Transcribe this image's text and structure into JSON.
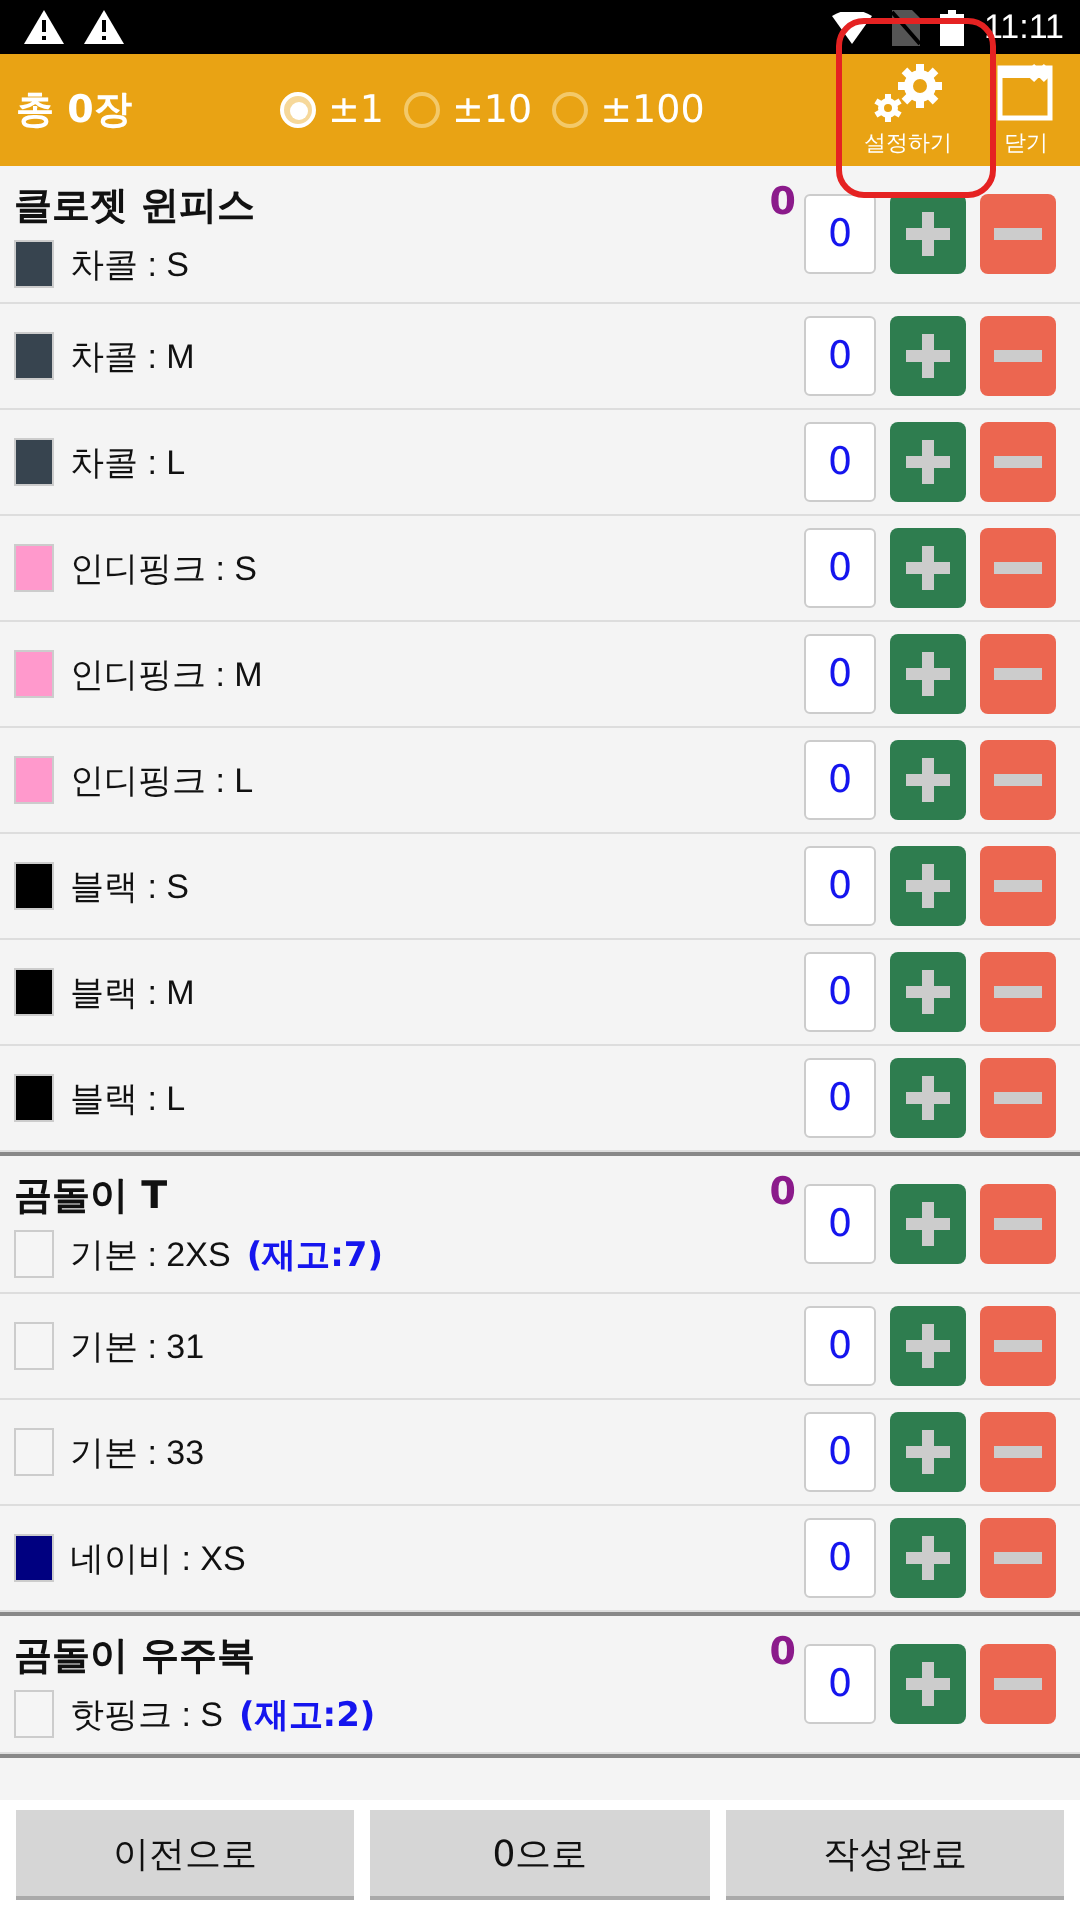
{
  "status_bar": {
    "time": "11:11"
  },
  "app_bar": {
    "total": "총 0장",
    "steps": [
      {
        "label": "±1",
        "selected": true
      },
      {
        "label": "±10",
        "selected": false
      },
      {
        "label": "±100",
        "selected": false
      }
    ],
    "actions": [
      {
        "kind": "settings",
        "label": "설정하기",
        "highlighted": true
      },
      {
        "kind": "close",
        "label": "닫기",
        "highlighted": false
      }
    ]
  },
  "groups": [
    {
      "name": "클로젯 윈피스",
      "total": "0",
      "items": [
        {
          "label": "차콜 : S",
          "color": "#37444f",
          "count": "0"
        },
        {
          "label": "차콜 : M",
          "color": "#37444f",
          "count": "0"
        },
        {
          "label": "차콜 : L",
          "color": "#37444f",
          "count": "0"
        },
        {
          "label": "인디핑크 : S",
          "color": "#ff99cc",
          "count": "0"
        },
        {
          "label": "인디핑크 : M",
          "color": "#ff99cc",
          "count": "0"
        },
        {
          "label": "인디핑크 : L",
          "color": "#ff99cc",
          "count": "0"
        },
        {
          "label": "블랙 : S",
          "color": "#000000",
          "count": "0"
        },
        {
          "label": "블랙 : M",
          "color": "#000000",
          "count": "0"
        },
        {
          "label": "블랙 : L",
          "color": "#000000",
          "count": "0"
        }
      ]
    },
    {
      "name": "곰돌이 T",
      "total": "0",
      "items": [
        {
          "label": "기본 : 2XS",
          "stock": "(재고:7)",
          "color": "#f5f5f5",
          "count": "0"
        },
        {
          "label": "기본 : 31",
          "color": "#f5f5f5",
          "count": "0"
        },
        {
          "label": "기본 : 33",
          "color": "#f5f5f5",
          "count": "0"
        },
        {
          "label": "네이비 : XS",
          "color": "#000080",
          "count": "0"
        }
      ]
    },
    {
      "name": "곰돌이 우주복",
      "total": "0",
      "items": [
        {
          "label": "핫핑크 : S",
          "stock": "(재고:2)",
          "color": "#f5f5f5",
          "count": "0"
        }
      ]
    }
  ],
  "buttons": [
    "이전으로",
    "0으로",
    "작성완료"
  ]
}
